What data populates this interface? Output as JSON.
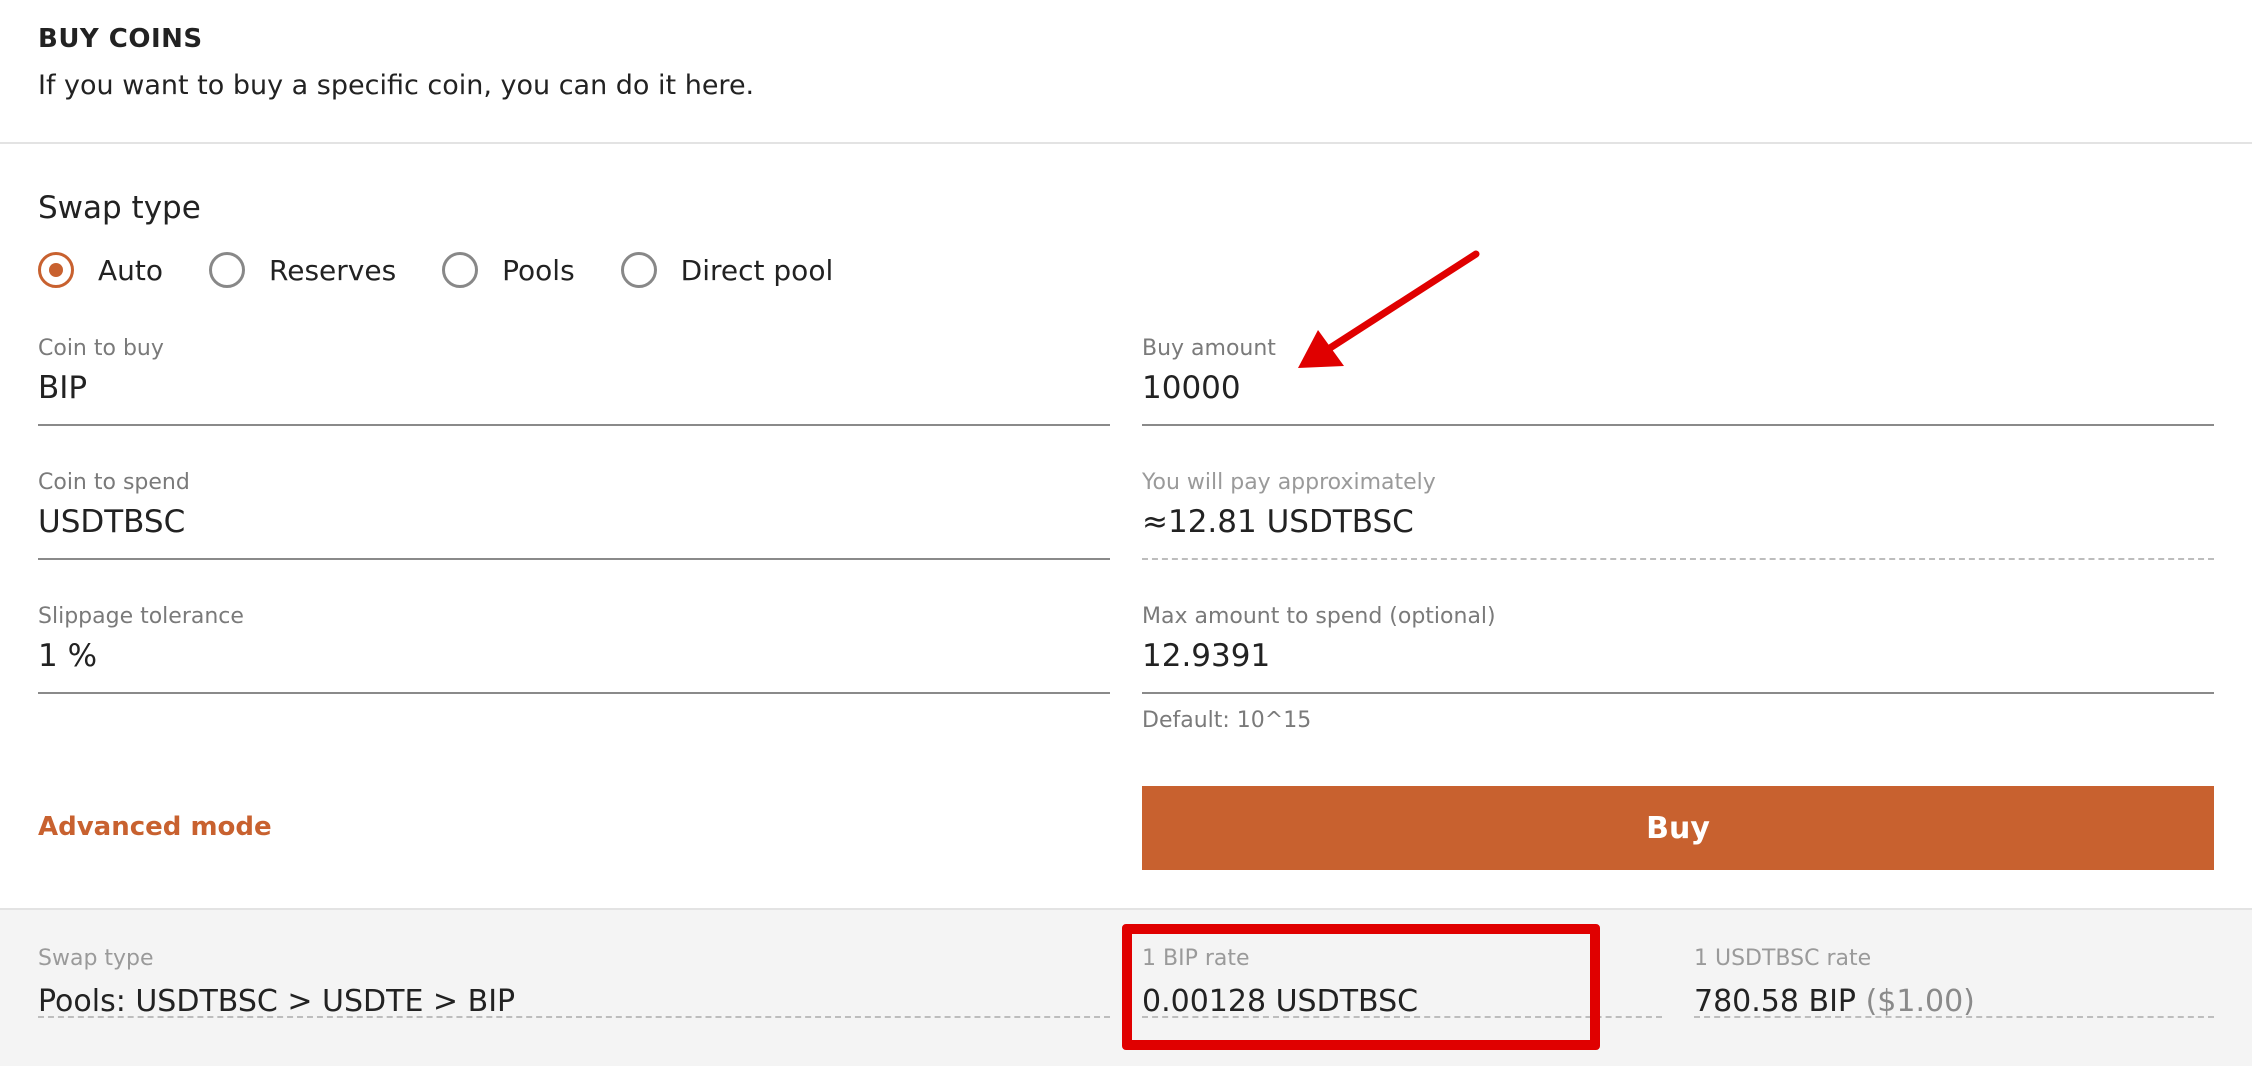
{
  "header": {
    "title": "BUY COINS",
    "subtitle": "If you want to buy a specific coin, you can do it here."
  },
  "swap_type": {
    "label": "Swap type",
    "options": [
      {
        "label": "Auto",
        "selected": true
      },
      {
        "label": "Reserves",
        "selected": false
      },
      {
        "label": "Pools",
        "selected": false
      },
      {
        "label": "Direct pool",
        "selected": false
      }
    ]
  },
  "form": {
    "coin_to_buy": {
      "label": "Coin to buy",
      "value": "BIP"
    },
    "buy_amount": {
      "label": "Buy amount",
      "value": "10000"
    },
    "coin_to_spend": {
      "label": "Coin to spend",
      "value": "USDTBSC"
    },
    "pay_approx": {
      "label": "You will pay approximately",
      "value": "≈12.81 USDTBSC"
    },
    "slippage": {
      "label": "Slippage tolerance",
      "value": "1 %"
    },
    "max_spend": {
      "label": "Max amount to spend (optional)",
      "value": "12.9391",
      "hint": "Default: 10^15"
    }
  },
  "actions": {
    "advanced_mode": "Advanced mode",
    "buy": "Buy"
  },
  "summary": {
    "swap_type": {
      "label": "Swap type",
      "value": "Pools: USDTBSC > USDTE > BIP"
    },
    "bip_rate": {
      "label": "1 BIP rate",
      "value": "0.00128 USDTBSC"
    },
    "usdtbsc_rate": {
      "label": "1 USDTBSC rate",
      "value": "780.58 BIP",
      "usd": "($1.00)"
    }
  },
  "colors": {
    "accent": "#c8612f",
    "annotation": "#e00000"
  }
}
